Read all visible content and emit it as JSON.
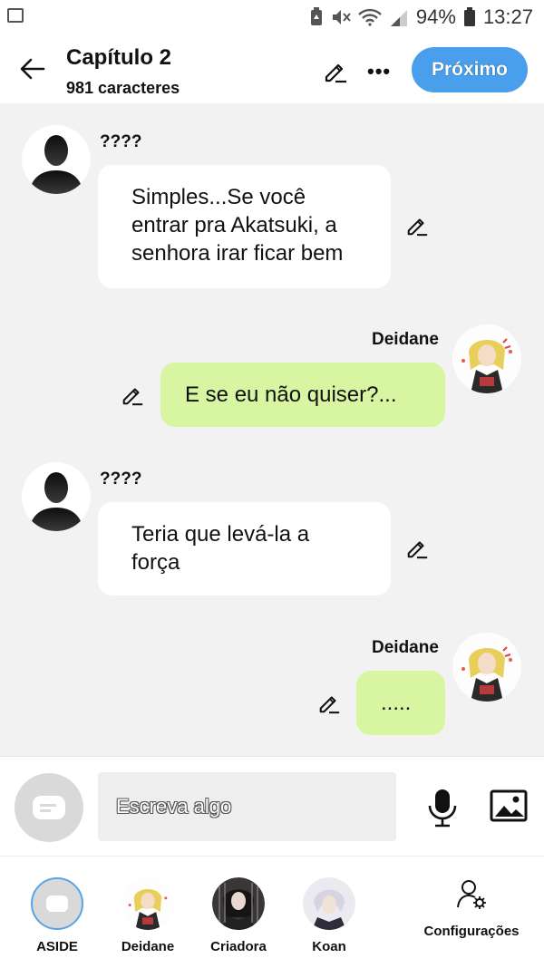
{
  "status_bar": {
    "battery": "94%",
    "time": "13:27"
  },
  "header": {
    "title": "Capítulo 2",
    "subtitle": "981 caracteres",
    "next_label": "Próximo"
  },
  "messages": [
    {
      "side": "left",
      "name": "????",
      "text": "Simples...Se você entrar pra Akatsuki, a senhora irar ficar bem"
    },
    {
      "side": "right",
      "name": "Deidane",
      "text": "E se eu não quiser?..."
    },
    {
      "side": "left",
      "name": "????",
      "text": "Teria que levá-la a força"
    },
    {
      "side": "right",
      "name": "Deidane",
      "text": "....."
    }
  ],
  "composer": {
    "placeholder": "Escreva algo"
  },
  "characters": [
    {
      "label": "ASIDE"
    },
    {
      "label": "Deidane"
    },
    {
      "label": "Criadora"
    },
    {
      "label": "Koan"
    }
  ],
  "settings_label": "Configurações",
  "colors": {
    "accent": "#4a9fec",
    "right_bubble": "#d8f5a2",
    "left_bubble": "#ffffff",
    "background": "#f2f2f2"
  }
}
